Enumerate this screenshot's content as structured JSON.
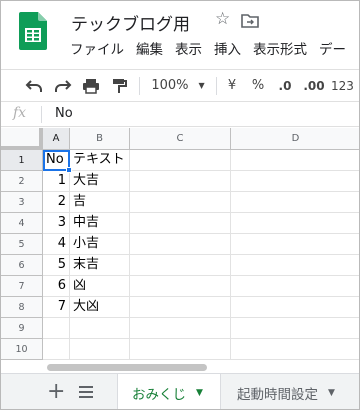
{
  "document": {
    "title": "テックブログ用"
  },
  "menu": [
    "ファイル",
    "編集",
    "表示",
    "挿入",
    "表示形式",
    "デー"
  ],
  "toolbar": {
    "zoom": "100%",
    "currency": "¥",
    "percent": "%",
    "decrease_decimal": ".0",
    "increase_decimal": ".00",
    "more_formats": "123"
  },
  "formula_bar": {
    "icon": "fx",
    "value": "No"
  },
  "grid": {
    "columns": [
      "A",
      "B",
      "C",
      "D"
    ],
    "row_numbers": [
      "1",
      "2",
      "3",
      "4",
      "5",
      "6",
      "7",
      "8",
      "9",
      "10"
    ],
    "rows": [
      [
        "No",
        "テキスト",
        "",
        ""
      ],
      [
        "1",
        "大吉",
        "",
        ""
      ],
      [
        "2",
        "吉",
        "",
        ""
      ],
      [
        "3",
        "中吉",
        "",
        ""
      ],
      [
        "4",
        "小吉",
        "",
        ""
      ],
      [
        "5",
        "末吉",
        "",
        ""
      ],
      [
        "6",
        "凶",
        "",
        ""
      ],
      [
        "7",
        "大凶",
        "",
        ""
      ],
      [
        "",
        "",
        "",
        ""
      ],
      [
        "",
        "",
        "",
        ""
      ]
    ],
    "selected_cell": "A1"
  },
  "sheets": {
    "active": "おみくじ",
    "other": "起動時間設定"
  },
  "colors": {
    "sheets_green": "#0f9d58",
    "selection_blue": "#1a73e8",
    "active_tab_text": "#188038"
  }
}
